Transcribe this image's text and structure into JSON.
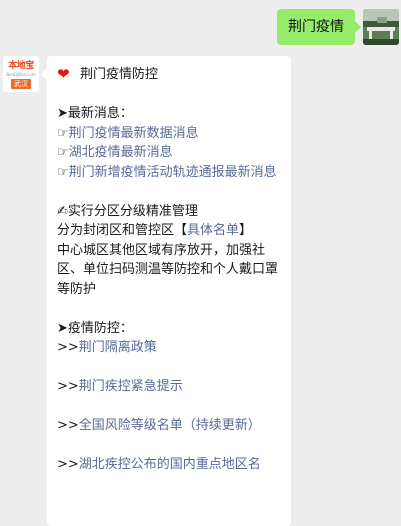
{
  "outgoing": {
    "text": "荆门疫情"
  },
  "bot": {
    "avatar_brand": "本地宝",
    "avatar_domain": "BenDiBao.com",
    "avatar_city": "武汉"
  },
  "reply": {
    "title": "荆门疫情防控",
    "latest": {
      "heading": "最新消息：",
      "links": [
        "荆门疫情最新数据消息",
        "湖北疫情最新消息",
        "荆门新增疫情活动轨迹通报最新消息"
      ]
    },
    "zoning": {
      "heading": "实行分区分级精准管理",
      "intro": "分为封闭区和管控区",
      "bracket_open": "【",
      "link": "具体名单",
      "bracket_close": "】",
      "body": "中心城区其他区域有序放开，加强社区、单位扫码测温等防控和个人戴口罩等防护"
    },
    "control": {
      "heading": "疫情防控：",
      "prefix": ">>",
      "links": [
        "荆门隔离政策",
        "荆门疾控紧急提示",
        "全国风险等级名单（持续更新）",
        "湖北疾控公布的国内重点地区名"
      ]
    }
  },
  "icons": {
    "heart": "heart-icon",
    "arrow": "black-arrow-icon",
    "pointer": "pointing-hand-icon",
    "pen": "writing-hand-icon"
  },
  "colors": {
    "outgoing_bubble": "#95ec69",
    "link": "#576b95",
    "heart": "#d81e06",
    "brand": "#e8491d"
  }
}
